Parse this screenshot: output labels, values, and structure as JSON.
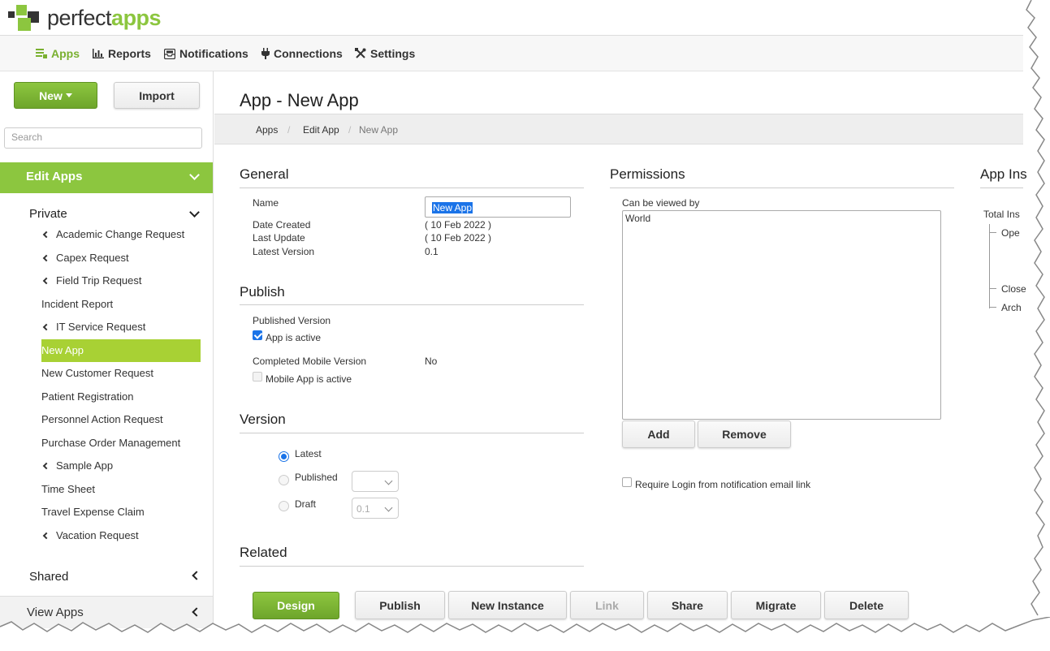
{
  "logo": {
    "part1": "perfect",
    "part2": "apps"
  },
  "nav": [
    {
      "label": "Apps",
      "icon": "list-icon",
      "active": true
    },
    {
      "label": "Reports",
      "icon": "bar-chart-icon"
    },
    {
      "label": "Notifications",
      "icon": "inbox-icon"
    },
    {
      "label": "Connections",
      "icon": "plug-icon"
    },
    {
      "label": "Settings",
      "icon": "tools-icon"
    }
  ],
  "sidebar": {
    "new_label": "New",
    "import_label": "Import",
    "search_placeholder": "Search",
    "edit_apps_label": "Edit Apps",
    "private_label": "Private",
    "apps": [
      {
        "label": "Academic Change Request",
        "has_children": true
      },
      {
        "label": "Capex Request",
        "has_children": true
      },
      {
        "label": "Field Trip Request",
        "has_children": true
      },
      {
        "label": "Incident Report",
        "has_children": false
      },
      {
        "label": "IT Service Request",
        "has_children": true
      },
      {
        "label": "New App",
        "has_children": false,
        "active": true
      },
      {
        "label": "New Customer Request",
        "has_children": false
      },
      {
        "label": "Patient Registration",
        "has_children": false
      },
      {
        "label": "Personnel Action Request",
        "has_children": false
      },
      {
        "label": "Purchase Order Management",
        "has_children": false
      },
      {
        "label": "Sample App",
        "has_children": true
      },
      {
        "label": "Time Sheet",
        "has_children": false
      },
      {
        "label": "Travel Expense Claim",
        "has_children": false
      },
      {
        "label": "Vacation Request",
        "has_children": true
      }
    ],
    "shared_label": "Shared",
    "view_apps_label": "View Apps"
  },
  "main": {
    "title": "App - New App",
    "breadcrumb": [
      "Apps",
      "Edit App",
      "New App"
    ]
  },
  "general": {
    "heading": "General",
    "name_label": "Name",
    "name_value": "New App",
    "date_created_label": "Date Created",
    "date_created_value": "( 10 Feb 2022 )",
    "last_update_label": "Last Update",
    "last_update_value": "( 10 Feb 2022 )",
    "latest_version_label": "Latest Version",
    "latest_version_value": "0.1"
  },
  "publish": {
    "heading": "Publish",
    "published_version_label": "Published Version",
    "app_active_label": "App is active",
    "app_active_checked": true,
    "completed_mobile_label": "Completed Mobile Version",
    "completed_mobile_value": "No",
    "mobile_active_label": "Mobile App is active",
    "mobile_active_checked": false
  },
  "version": {
    "heading": "Version",
    "latest_label": "Latest",
    "published_label": "Published",
    "published_select": "",
    "draft_label": "Draft",
    "draft_select": "0.1",
    "selected": "Latest"
  },
  "related": {
    "heading": "Related"
  },
  "permissions": {
    "heading": "Permissions",
    "viewed_by_label": "Can be viewed by",
    "viewers": [
      "World"
    ],
    "add_label": "Add",
    "remove_label": "Remove",
    "require_login_label": "Require Login from notification email link",
    "require_login_checked": false
  },
  "instances": {
    "heading": "App Ins",
    "total_label": "Total Ins",
    "open_label": "Ope",
    "closed_label": "Close",
    "archived_label": "Arch"
  },
  "actions": {
    "design": "Design",
    "publish": "Publish",
    "new_instance": "New Instance",
    "link": "Link",
    "share": "Share",
    "migrate": "Migrate",
    "delete": "Delete"
  },
  "colors": {
    "brand_green": "#8cc63f",
    "active_item": "#a8d134",
    "accent_blue": "#1a73e8"
  }
}
